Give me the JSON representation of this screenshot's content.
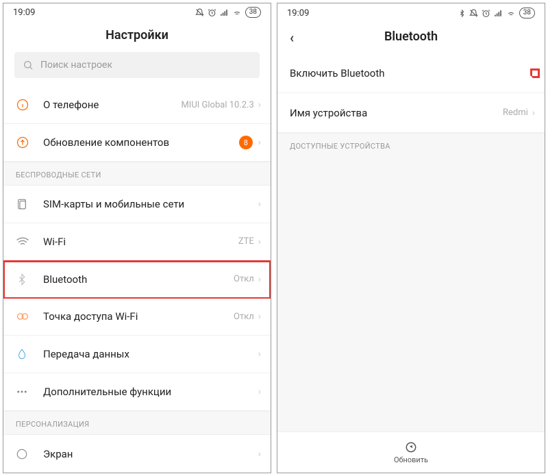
{
  "statusbar": {
    "time": "19:09",
    "battery": "38"
  },
  "left": {
    "title": "Настройки",
    "search_placeholder": "Поиск настроек",
    "rows": {
      "about": {
        "label": "О телефоне",
        "value": "MIUI Global 10.2.3"
      },
      "updates": {
        "label": "Обновление компонентов",
        "badge": "8"
      }
    },
    "section_wireless": "БЕСПРОВОДНЫЕ СЕТИ",
    "wireless": {
      "sim": {
        "label": "SIM-карты и мобильные сети"
      },
      "wifi": {
        "label": "Wi-Fi",
        "value": "ZTE"
      },
      "bluetooth": {
        "label": "Bluetooth",
        "value": "Откл"
      },
      "hotspot": {
        "label": "Точка доступа Wi-Fi",
        "value": "Откл"
      },
      "data": {
        "label": "Передача данных"
      },
      "more": {
        "label": "Дополнительные функции"
      }
    },
    "section_personalization": "ПЕРСОНАЛИЗАЦИЯ",
    "personalization": {
      "display": {
        "label": "Экран"
      }
    }
  },
  "right": {
    "title": "Bluetooth",
    "enable_label": "Включить Bluetooth",
    "device_name_label": "Имя устройства",
    "device_name_value": "Redmi",
    "section_available": "ДОСТУПНЫЕ УСТРОЙСТВА",
    "refresh_label": "Обновить"
  }
}
